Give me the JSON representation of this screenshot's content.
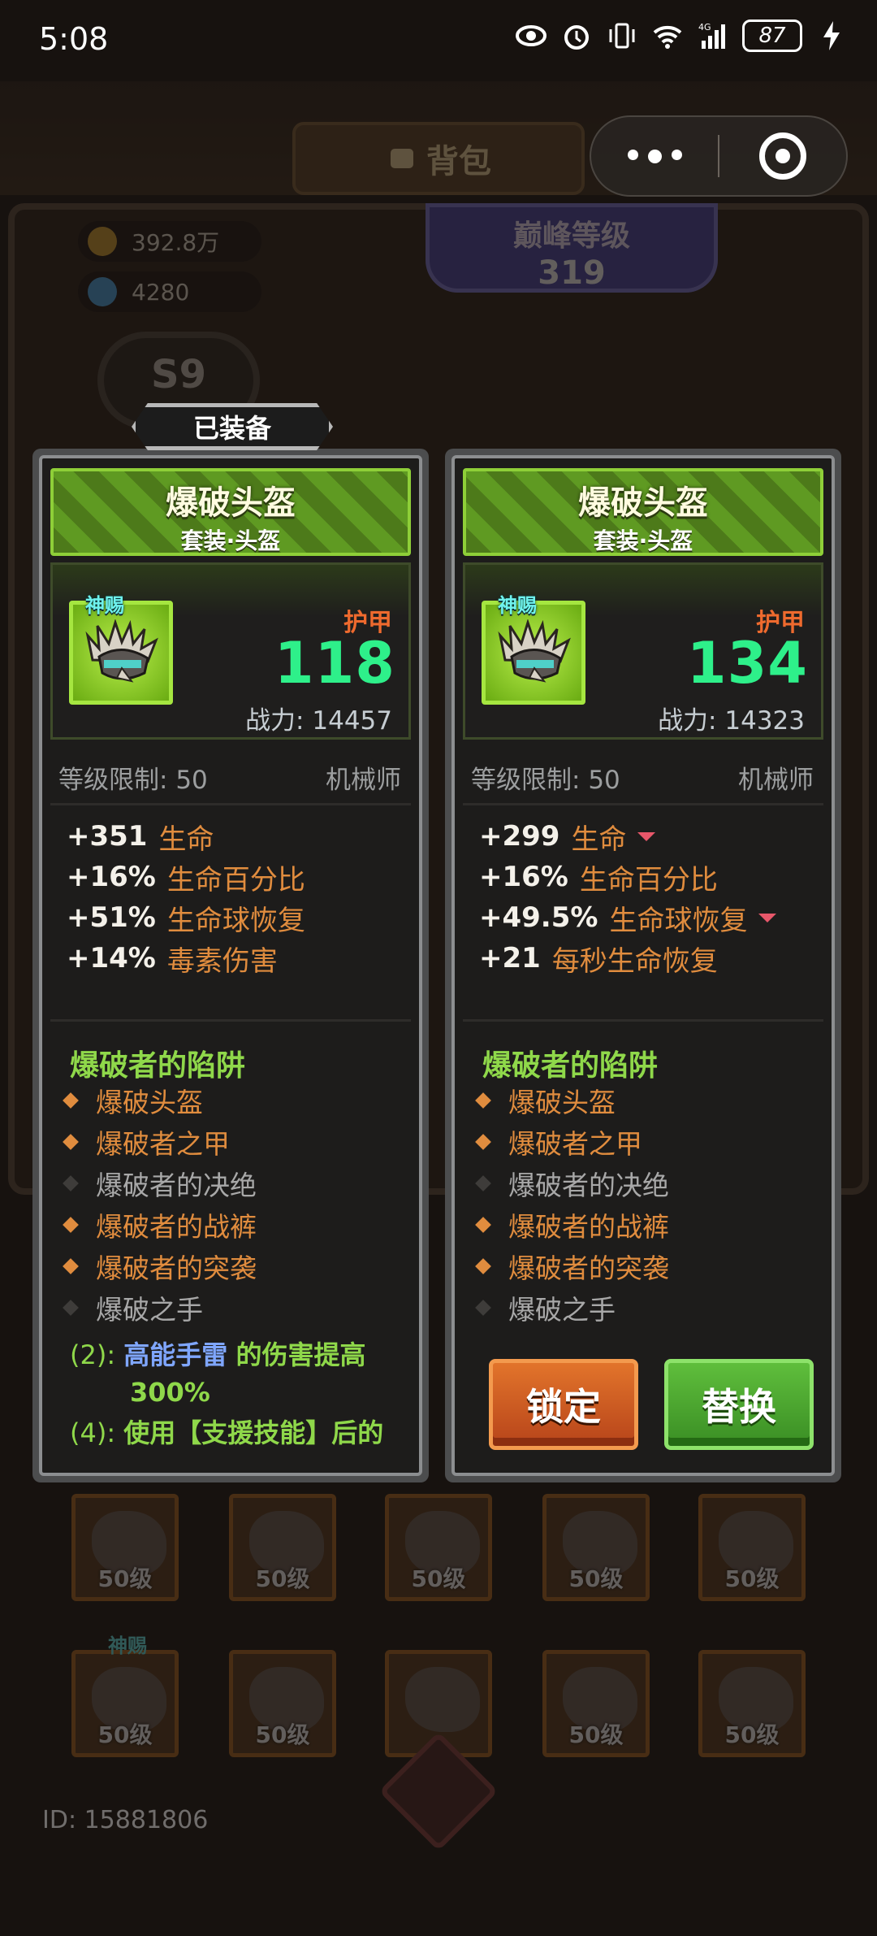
{
  "status_bar": {
    "time": "5:08",
    "signal": "4G",
    "battery": "87"
  },
  "background": {
    "tab_label": "背包",
    "gold": "392.8万",
    "gems": "4280",
    "peak_title": "巅峰等级",
    "peak_level": "319",
    "season": "S9",
    "slot_level": "50级",
    "god_label": "神赐",
    "player_id": "ID: 15881806"
  },
  "equipped_label": "已装备",
  "cards": [
    {
      "name": "爆破头盔",
      "subtitle": "套装·头盔",
      "god_label": "神赐",
      "armor_label": "护甲",
      "armor_value": "118",
      "power_label": "战力:",
      "power_value": "14457",
      "level_limit_label": "等级限制:",
      "level_limit": "50",
      "class": "机械师",
      "attrs": [
        {
          "value": "+351",
          "name": "生命",
          "down": false
        },
        {
          "value": "+16%",
          "name": "生命百分比",
          "down": false
        },
        {
          "value": "+51%",
          "name": "生命球恢复",
          "down": false
        },
        {
          "value": "+14%",
          "name": "毒素伤害",
          "down": false
        }
      ],
      "set_title": "爆破者的陷阱",
      "set_items": [
        {
          "name": "爆破头盔",
          "active": true
        },
        {
          "name": "爆破者之甲",
          "active": true
        },
        {
          "name": "爆破者的决绝",
          "active": false
        },
        {
          "name": "爆破者的战裤",
          "active": true
        },
        {
          "name": "爆破者的突袭",
          "active": true
        },
        {
          "name": "爆破之手",
          "active": false
        }
      ],
      "bonus2_key": "(2):",
      "bonus2_skill": "高能手雷",
      "bonus2_text": "的伤害提高",
      "bonus2_pct": "300%",
      "bonus4_key": "(4):",
      "bonus4_text": "使用【支援技能】后的"
    },
    {
      "name": "爆破头盔",
      "subtitle": "套装·头盔",
      "god_label": "神赐",
      "armor_label": "护甲",
      "armor_value": "134",
      "power_label": "战力:",
      "power_value": "14323",
      "level_limit_label": "等级限制:",
      "level_limit": "50",
      "class": "机械师",
      "attrs": [
        {
          "value": "+299",
          "name": "生命",
          "down": true
        },
        {
          "value": "+16%",
          "name": "生命百分比",
          "down": false
        },
        {
          "value": "+49.5%",
          "name": "生命球恢复",
          "down": true
        },
        {
          "value": "+21",
          "name": "每秒生命恢复",
          "down": false
        }
      ],
      "set_title": "爆破者的陷阱",
      "set_items": [
        {
          "name": "爆破头盔",
          "active": true
        },
        {
          "name": "爆破者之甲",
          "active": true
        },
        {
          "name": "爆破者的决绝",
          "active": false
        },
        {
          "name": "爆破者的战裤",
          "active": true
        },
        {
          "name": "爆破者的突袭",
          "active": true
        },
        {
          "name": "爆破之手",
          "active": false
        }
      ],
      "lock_label": "锁定",
      "swap_label": "替换"
    }
  ]
}
